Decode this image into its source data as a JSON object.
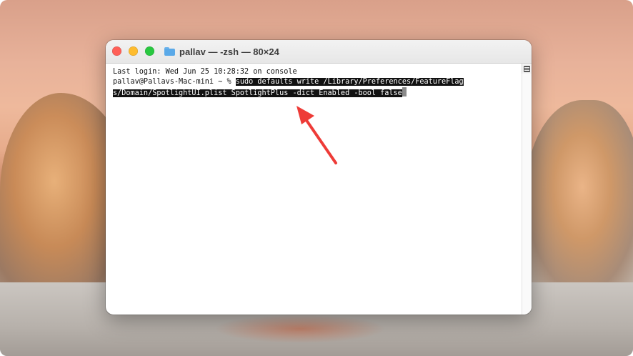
{
  "window": {
    "title": "pallav — -zsh — 80×24"
  },
  "terminal": {
    "lines": [
      "Last login: Wed Jun 25 10:28:32 on console",
      "pallav@Pallavs-Mac-mini ~ % "
    ],
    "command_part1": "sudo defaults write /Library/Preferences/FeatureFlag",
    "command_part2": "s/Domain/SpotlightUI.plist SpotlightPlus -dict Enabled -bool false"
  },
  "colors": {
    "annotation_arrow": "#ee3b37",
    "selection_bg": "#111111"
  },
  "icons": {
    "folder": "folder-icon",
    "scroll_menu": "scroll-menu-icon"
  }
}
